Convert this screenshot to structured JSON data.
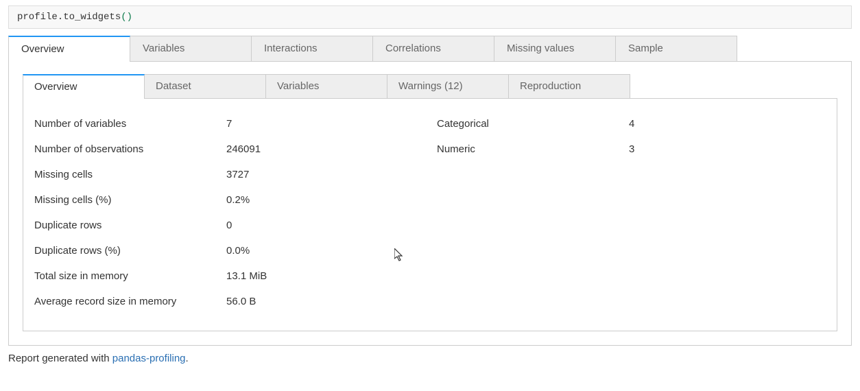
{
  "code_cell": {
    "text": "profile.to_widgets",
    "parens": "()"
  },
  "outer_tabs": [
    {
      "label": "Overview",
      "active": true
    },
    {
      "label": "Variables",
      "active": false
    },
    {
      "label": "Interactions",
      "active": false
    },
    {
      "label": "Correlations",
      "active": false
    },
    {
      "label": "Missing values",
      "active": false
    },
    {
      "label": "Sample",
      "active": false
    }
  ],
  "inner_tabs": [
    {
      "label": "Overview",
      "active": true
    },
    {
      "label": "Dataset",
      "active": false
    },
    {
      "label": "Variables",
      "active": false
    },
    {
      "label": "Warnings (12)",
      "active": false
    },
    {
      "label": "Reproduction",
      "active": false
    }
  ],
  "stats_left": [
    {
      "label": "Number of variables",
      "value": "7"
    },
    {
      "label": "Number of observations",
      "value": "246091"
    },
    {
      "label": "Missing cells",
      "value": "3727"
    },
    {
      "label": "Missing cells (%)",
      "value": "0.2%"
    },
    {
      "label": "Duplicate rows",
      "value": "0"
    },
    {
      "label": "Duplicate rows (%)",
      "value": "0.0%"
    },
    {
      "label": "Total size in memory",
      "value": "13.1 MiB"
    },
    {
      "label": "Average record size in memory",
      "value": "56.0 B"
    }
  ],
  "stats_right": [
    {
      "label": "Categorical",
      "value": "4"
    },
    {
      "label": "Numeric",
      "value": "3"
    }
  ],
  "footer": {
    "prefix": "Report generated with ",
    "link_text": "pandas-profiling",
    "suffix": "."
  }
}
